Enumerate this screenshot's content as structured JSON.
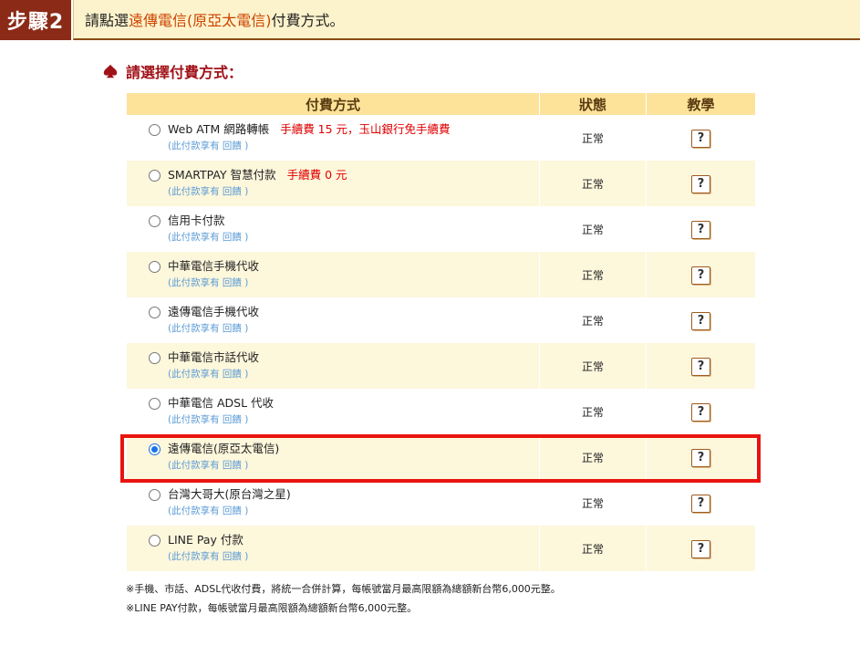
{
  "step": {
    "badge": "步驟2",
    "instruction_prefix": "請點選",
    "instruction_highlight": "遠傳電信(原亞太電信)",
    "instruction_suffix": "付費方式。"
  },
  "section": {
    "title": "請選擇付費方式：",
    "icon": "spade-icon"
  },
  "table": {
    "headers": {
      "method": "付費方式",
      "status": "狀態",
      "guide": "教學"
    },
    "rows": [
      {
        "name": "Web ATM 網路轉帳",
        "fee": "手續費 15 元，玉山銀行免手續費",
        "sub": "(此付款享有 回饋 )",
        "status": "正常",
        "help": "?",
        "selected": false
      },
      {
        "name": "SMARTPAY 智慧付款",
        "fee": "手續費 0 元",
        "sub": "(此付款享有 回饋 )",
        "status": "正常",
        "help": "?",
        "selected": false
      },
      {
        "name": "信用卡付款",
        "fee": "",
        "sub": "(此付款享有 回饋 )",
        "status": "正常",
        "help": "?",
        "selected": false
      },
      {
        "name": "中華電信手機代收",
        "fee": "",
        "sub": "(此付款享有 回饋 )",
        "status": "正常",
        "help": "?",
        "selected": false
      },
      {
        "name": "遠傳電信手機代收",
        "fee": "",
        "sub": "(此付款享有 回饋 )",
        "status": "正常",
        "help": "?",
        "selected": false
      },
      {
        "name": "中華電信市話代收",
        "fee": "",
        "sub": "(此付款享有 回饋 )",
        "status": "正常",
        "help": "?",
        "selected": false
      },
      {
        "name": "中華電信 ADSL 代收",
        "fee": "",
        "sub": "(此付款享有 回饋 )",
        "status": "正常",
        "help": "?",
        "selected": false
      },
      {
        "name": "遠傳電信(原亞太電信)",
        "fee": "",
        "sub": "(此付款享有 回饋 )",
        "status": "正常",
        "help": "?",
        "selected": true
      },
      {
        "name": "台灣大哥大(原台灣之星)",
        "fee": "",
        "sub": "(此付款享有 回饋 )",
        "status": "正常",
        "help": "?",
        "selected": false
      },
      {
        "name": "LINE Pay 付款",
        "fee": "",
        "sub": "(此付款享有 回饋 )",
        "status": "正常",
        "help": "?",
        "selected": false
      }
    ]
  },
  "notes": [
    "※手機、市話、ADSL代收付費，將統一合併計算，每帳號當月最高限額為總額新台幣6,000元整。",
    "※LINE PAY付款，每帳號當月最高限額為總額新台幣6,000元整。"
  ],
  "colors": {
    "badge_bg": "#8b2a16",
    "header_bg": "#fde39a",
    "highlight_border": "#e8150f",
    "fee_text": "#e00000",
    "sub_text": "#5b9bd5"
  }
}
